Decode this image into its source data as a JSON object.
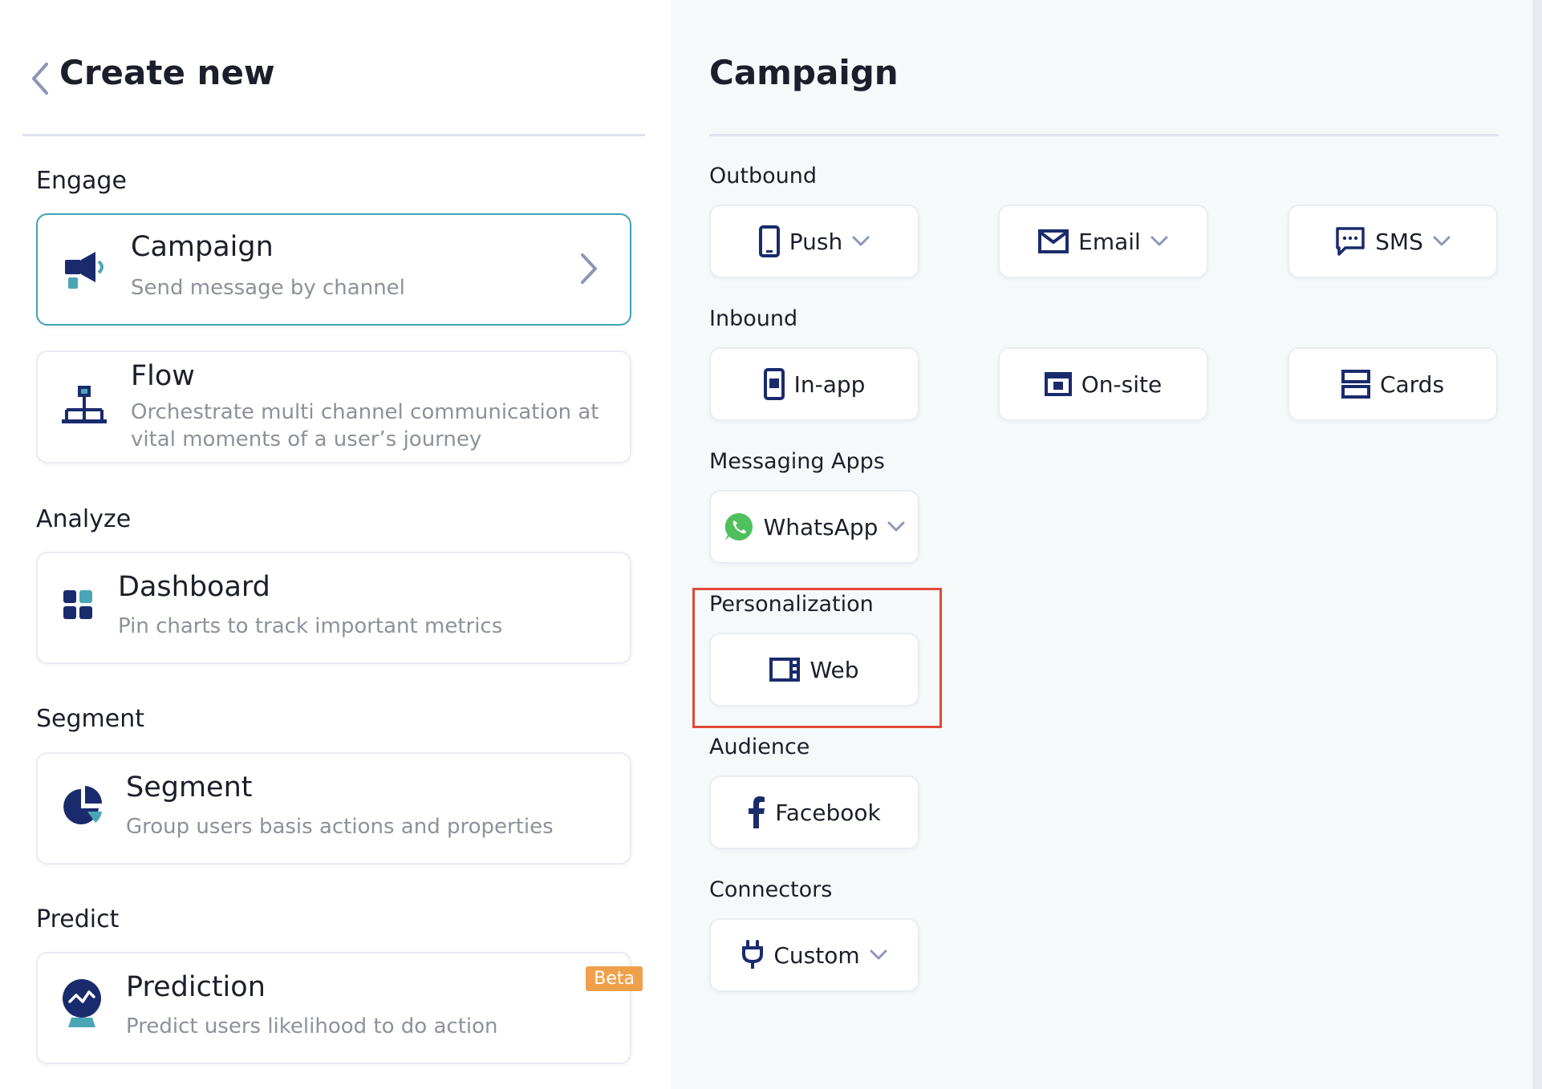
{
  "left": {
    "title": "Create new",
    "sections": [
      {
        "label": "Engage"
      },
      {
        "label": "Analyze"
      },
      {
        "label": "Segment"
      },
      {
        "label": "Predict"
      }
    ],
    "cards": {
      "campaign": {
        "title": "Campaign",
        "desc": "Send message by channel"
      },
      "flow": {
        "title": "Flow",
        "desc": "Orchestrate multi channel communication at vital moments of a user’s journey"
      },
      "dashboard": {
        "title": "Dashboard",
        "desc": "Pin charts to track important metrics"
      },
      "segment": {
        "title": "Segment",
        "desc": "Group users basis actions and properties"
      },
      "prediction": {
        "title": "Prediction",
        "desc": "Predict users likelihood to do action",
        "badge": "Beta"
      }
    }
  },
  "right": {
    "title": "Campaign",
    "groups": {
      "outbound": "Outbound",
      "inbound": "Inbound",
      "messaging": "Messaging Apps",
      "personalization": "Personalization",
      "audience": "Audience",
      "connectors": "Connectors"
    },
    "channels": {
      "push": "Push",
      "email": "Email",
      "sms": "SMS",
      "inapp": "In-app",
      "onsite": "On-site",
      "cards": "Cards",
      "whatsapp": "WhatsApp",
      "web": "Web",
      "facebook": "Facebook",
      "custom": "Custom"
    }
  },
  "icons": {
    "back": "chevron-left-icon",
    "card_arrow": "chevron-right-icon",
    "dropdown": "chevron-down-icon"
  },
  "colors": {
    "navy": "#1a2b6d",
    "teal": "#4aa6b6",
    "selected_border": "#3fa3b4",
    "beta": "#f0a04b",
    "highlight": "#e0493a",
    "whatsapp": "#4fc05d"
  }
}
